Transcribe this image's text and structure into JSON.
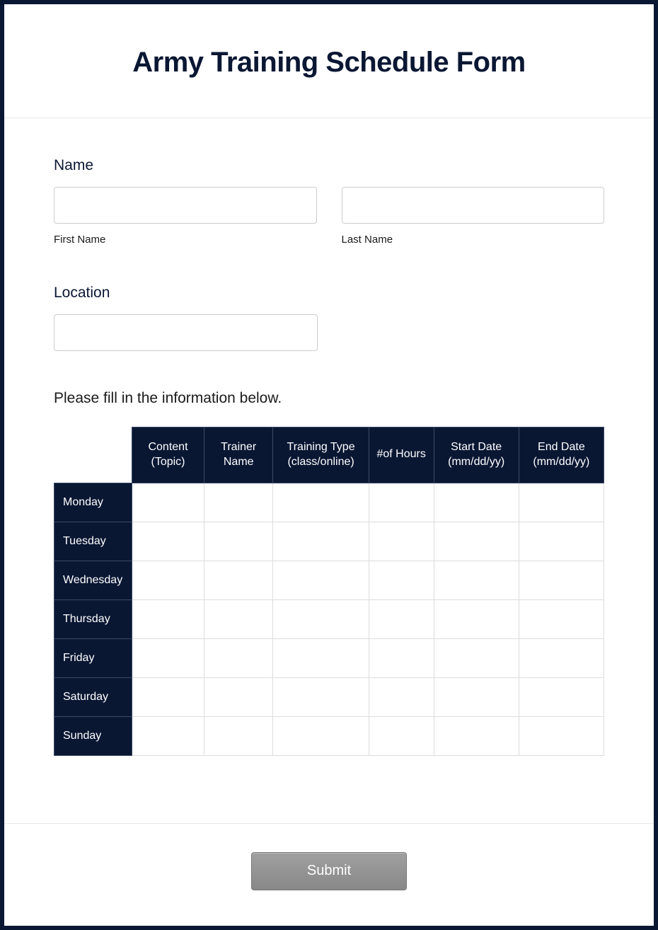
{
  "header": {
    "title": "Army Training Schedule Form"
  },
  "name": {
    "label": "Name",
    "first_sublabel": "First Name",
    "last_sublabel": "Last Name",
    "first_value": "",
    "last_value": ""
  },
  "location": {
    "label": "Location",
    "value": ""
  },
  "table": {
    "instruction": "Please fill in the information below.",
    "columns": [
      "Content (Topic)",
      "Trainer Name",
      "Training Type (class/online)",
      "#of Hours",
      "Start Date (mm/dd/yy)",
      "End Date (mm/dd/yy)"
    ],
    "rows": [
      "Monday",
      "Tuesday",
      "Wednesday",
      "Thursday",
      "Friday",
      "Saturday",
      "Sunday"
    ]
  },
  "footer": {
    "submit_label": "Submit"
  }
}
